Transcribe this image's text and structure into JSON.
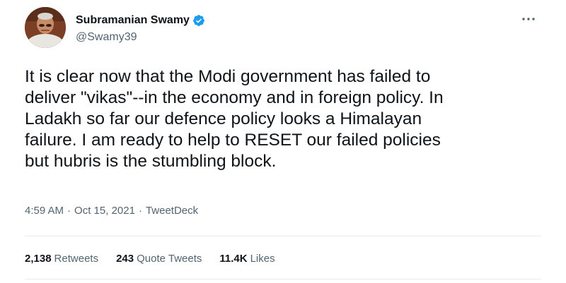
{
  "author": {
    "display_name": "Subramanian Swamy",
    "handle": "@Swamy39",
    "verified": true,
    "verified_color": "#1d9bf0"
  },
  "tweet": {
    "text": "It is clear now that the Modi government has failed to\ndeliver \"vikas\"--in the economy and in foreign policy. In\nLadakh so far our defence policy looks a Himalayan\nfailure. I am ready to help to RESET our failed policies\nbut hubris is the stumbling block."
  },
  "meta": {
    "time": "4:59 AM",
    "separator_1": "·",
    "date": "Oct 15, 2021",
    "separator_2": "·",
    "source": "TweetDeck"
  },
  "stats": {
    "retweets": {
      "count": "2,138",
      "label": "Retweets"
    },
    "quote_tweets": {
      "count": "243",
      "label": "Quote Tweets"
    },
    "likes": {
      "count": "11.4K",
      "label": "Likes"
    }
  },
  "icons": {
    "more": "more-horizontal-icon",
    "verified": "verified-badge-icon"
  }
}
